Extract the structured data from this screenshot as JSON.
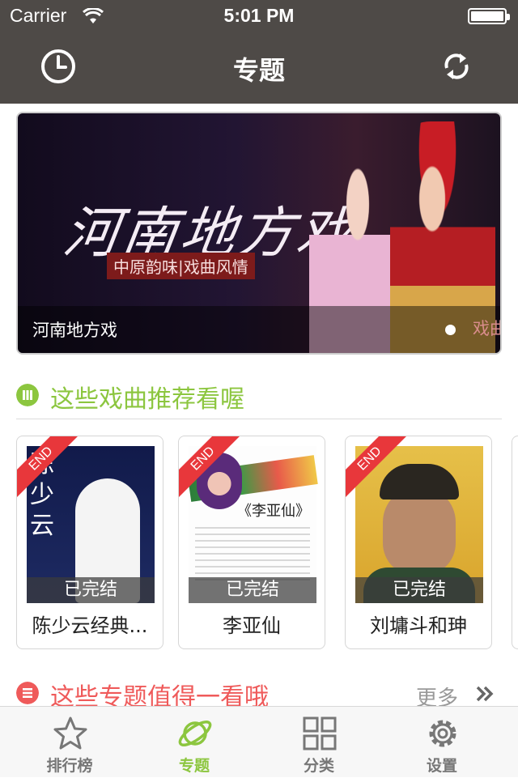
{
  "status": {
    "carrier": "Carrier",
    "time": "5:01 PM"
  },
  "nav": {
    "title": "专题",
    "left_icon": "clock-icon",
    "right_icon": "refresh-icon"
  },
  "banner": {
    "art_title": "河南地方戏",
    "art_subtitle": "中原韵味|戏曲风情",
    "caption": "河南地方戏",
    "next_caption": "戏曲",
    "page_count": 2,
    "current_page": 1
  },
  "section_recommend": {
    "title": "这些戏曲推荐看喔",
    "icon": "list-icon",
    "color": "#8cc63f"
  },
  "cards": [
    {
      "name": "陈少云经典...",
      "status": "已完结",
      "ribbon": "END",
      "poster_text": "陈少云"
    },
    {
      "name": "李亚仙",
      "status": "已完结",
      "ribbon": "END",
      "poster_text": "《李亚仙》"
    },
    {
      "name": "刘墉斗和珅",
      "status": "已完结",
      "ribbon": "END"
    }
  ],
  "section_topics": {
    "title": "这些专题值得一看哦",
    "more": "更多",
    "icon": "menu-icon",
    "color": "#ef5a5a"
  },
  "tabs": [
    {
      "label": "排行榜",
      "icon": "star-icon",
      "active": false
    },
    {
      "label": "专题",
      "icon": "planet-icon",
      "active": true
    },
    {
      "label": "分类",
      "icon": "grid-icon",
      "active": false
    },
    {
      "label": "设置",
      "icon": "gear-icon",
      "active": false
    }
  ],
  "colors": {
    "nav_bg": "#4e4a47",
    "accent_green": "#8cc63f",
    "accent_red": "#ef5a5a",
    "ribbon_red": "#e8373b"
  }
}
